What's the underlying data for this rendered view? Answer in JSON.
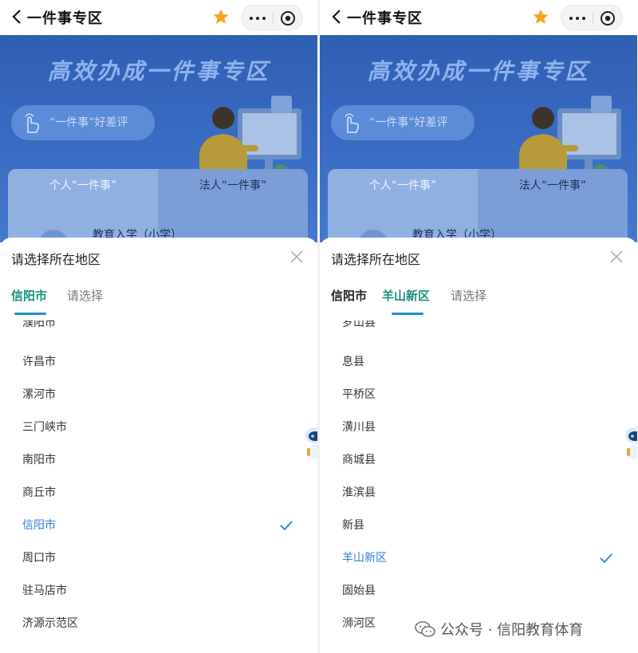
{
  "nav": {
    "title": "一件事专区"
  },
  "banner": {
    "title": "高效办成一件事专区",
    "review_label": "“一件事”好差评",
    "tab_personal": "个人“一件事”",
    "tab_legal": "法人“一件事”",
    "row_preview": "教育入学（小学）"
  },
  "sheet": {
    "title": "请选择所在地区"
  },
  "left": {
    "crumbs": [
      {
        "label": "信阳市",
        "state": "current"
      },
      {
        "label": "请选择",
        "state": "pending"
      }
    ],
    "clipped_item": "濮阳市",
    "items": [
      "许昌市",
      "漯河市",
      "三门峡市",
      "南阳市",
      "商丘市",
      "信阳市",
      "周口市",
      "驻马店市",
      "济源示范区"
    ],
    "selected": "信阳市"
  },
  "right": {
    "crumbs": [
      {
        "label": "信阳市",
        "state": "done"
      },
      {
        "label": "羊山新区",
        "state": "current"
      },
      {
        "label": "请选择",
        "state": "pending"
      }
    ],
    "clipped_item": "罗山县",
    "items": [
      "息县",
      "平桥区",
      "潢川县",
      "商城县",
      "淮滨县",
      "新县",
      "羊山新区",
      "固始县",
      "浉河区"
    ],
    "selected": "羊山新区"
  },
  "watermark": {
    "text": "公众号 · 信阳教育体育"
  },
  "colors": {
    "accent_green": "#1a8f7c",
    "selected_blue": "#2b7fd8",
    "star": "#f5a623",
    "banner": "#3a6cc4"
  },
  "icons": [
    "back-icon",
    "star-icon",
    "more-icon",
    "target-icon",
    "close-icon",
    "check-icon",
    "wechat-icon",
    "robot-icon",
    "hand-icon"
  ]
}
